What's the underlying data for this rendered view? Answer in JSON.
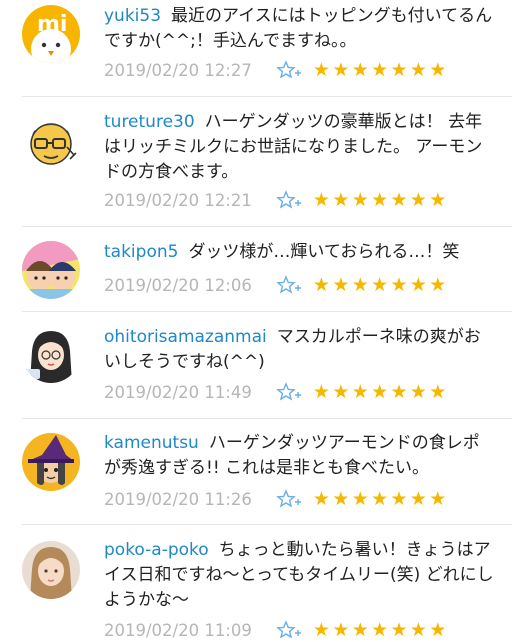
{
  "comments": [
    {
      "username": "yuki53",
      "text": "最近のアイスにはトッピングも付いてるんですか(^^;！手込んでますね。。",
      "timestamp": "2019/02/20 12:27",
      "stars": 7,
      "avatar": "mi-chick-icon"
    },
    {
      "username": "tureture30",
      "text": "ハーゲンダッツの豪華版とは！ 去年はリッチミルクにお世話になりました。 アーモンドの方食べます。",
      "timestamp": "2019/02/20 12:21",
      "stars": 7,
      "avatar": "glasses-man-icon"
    },
    {
      "username": "takipon5",
      "text": "ダッツ様が…輝いておられる…！笑",
      "timestamp": "2019/02/20 12:06",
      "stars": 7,
      "avatar": "two-characters-icon"
    },
    {
      "username": "ohitorisamazanmai",
      "text": "マスカルポーネ味の爽がおいしそうですね(^^)",
      "timestamp": "2019/02/20 11:49",
      "stars": 7,
      "avatar": "long-hair-girl-icon"
    },
    {
      "username": "kamenutsu",
      "text": "ハーゲンダッツアーモンドの食レポが秀逸すぎる!! これは是非とも食べたい。",
      "timestamp": "2019/02/20 11:26",
      "stars": 7,
      "avatar": "witch-hat-icon"
    },
    {
      "username": "poko-a-poko",
      "text": "ちょっと動いたら暑い！きょうはアイス日和ですね～とってもタイムリー(笑) どれにしようかな～",
      "timestamp": "2019/02/20 11:09",
      "stars": 7,
      "avatar": "woman-photo-icon"
    }
  ],
  "colors": {
    "username": "#1e88c8",
    "text": "#222222",
    "timestamp": "#b6b6b6",
    "star": "#f5b800",
    "star_add": "#6aaee6",
    "divider": "#e6e6e6"
  }
}
